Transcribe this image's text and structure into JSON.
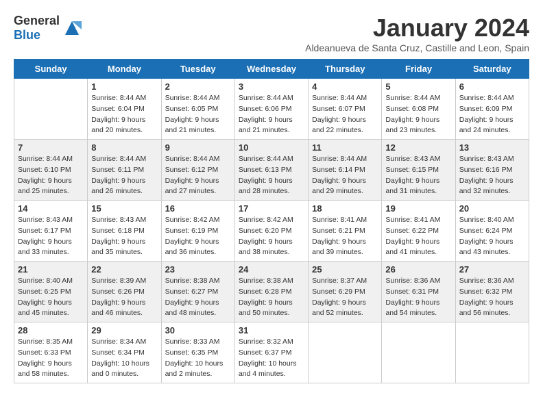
{
  "header": {
    "logo_general": "General",
    "logo_blue": "Blue",
    "month_title": "January 2024",
    "subtitle": "Aldeanueva de Santa Cruz, Castille and Leon, Spain"
  },
  "days_of_week": [
    "Sunday",
    "Monday",
    "Tuesday",
    "Wednesday",
    "Thursday",
    "Friday",
    "Saturday"
  ],
  "weeks": [
    {
      "shaded": false,
      "days": [
        {
          "number": "",
          "info": ""
        },
        {
          "number": "1",
          "info": "Sunrise: 8:44 AM\nSunset: 6:04 PM\nDaylight: 9 hours\nand 20 minutes."
        },
        {
          "number": "2",
          "info": "Sunrise: 8:44 AM\nSunset: 6:05 PM\nDaylight: 9 hours\nand 21 minutes."
        },
        {
          "number": "3",
          "info": "Sunrise: 8:44 AM\nSunset: 6:06 PM\nDaylight: 9 hours\nand 21 minutes."
        },
        {
          "number": "4",
          "info": "Sunrise: 8:44 AM\nSunset: 6:07 PM\nDaylight: 9 hours\nand 22 minutes."
        },
        {
          "number": "5",
          "info": "Sunrise: 8:44 AM\nSunset: 6:08 PM\nDaylight: 9 hours\nand 23 minutes."
        },
        {
          "number": "6",
          "info": "Sunrise: 8:44 AM\nSunset: 6:09 PM\nDaylight: 9 hours\nand 24 minutes."
        }
      ]
    },
    {
      "shaded": true,
      "days": [
        {
          "number": "7",
          "info": "Sunrise: 8:44 AM\nSunset: 6:10 PM\nDaylight: 9 hours\nand 25 minutes."
        },
        {
          "number": "8",
          "info": "Sunrise: 8:44 AM\nSunset: 6:11 PM\nDaylight: 9 hours\nand 26 minutes."
        },
        {
          "number": "9",
          "info": "Sunrise: 8:44 AM\nSunset: 6:12 PM\nDaylight: 9 hours\nand 27 minutes."
        },
        {
          "number": "10",
          "info": "Sunrise: 8:44 AM\nSunset: 6:13 PM\nDaylight: 9 hours\nand 28 minutes."
        },
        {
          "number": "11",
          "info": "Sunrise: 8:44 AM\nSunset: 6:14 PM\nDaylight: 9 hours\nand 29 minutes."
        },
        {
          "number": "12",
          "info": "Sunrise: 8:43 AM\nSunset: 6:15 PM\nDaylight: 9 hours\nand 31 minutes."
        },
        {
          "number": "13",
          "info": "Sunrise: 8:43 AM\nSunset: 6:16 PM\nDaylight: 9 hours\nand 32 minutes."
        }
      ]
    },
    {
      "shaded": false,
      "days": [
        {
          "number": "14",
          "info": "Sunrise: 8:43 AM\nSunset: 6:17 PM\nDaylight: 9 hours\nand 33 minutes."
        },
        {
          "number": "15",
          "info": "Sunrise: 8:43 AM\nSunset: 6:18 PM\nDaylight: 9 hours\nand 35 minutes."
        },
        {
          "number": "16",
          "info": "Sunrise: 8:42 AM\nSunset: 6:19 PM\nDaylight: 9 hours\nand 36 minutes."
        },
        {
          "number": "17",
          "info": "Sunrise: 8:42 AM\nSunset: 6:20 PM\nDaylight: 9 hours\nand 38 minutes."
        },
        {
          "number": "18",
          "info": "Sunrise: 8:41 AM\nSunset: 6:21 PM\nDaylight: 9 hours\nand 39 minutes."
        },
        {
          "number": "19",
          "info": "Sunrise: 8:41 AM\nSunset: 6:22 PM\nDaylight: 9 hours\nand 41 minutes."
        },
        {
          "number": "20",
          "info": "Sunrise: 8:40 AM\nSunset: 6:24 PM\nDaylight: 9 hours\nand 43 minutes."
        }
      ]
    },
    {
      "shaded": true,
      "days": [
        {
          "number": "21",
          "info": "Sunrise: 8:40 AM\nSunset: 6:25 PM\nDaylight: 9 hours\nand 45 minutes."
        },
        {
          "number": "22",
          "info": "Sunrise: 8:39 AM\nSunset: 6:26 PM\nDaylight: 9 hours\nand 46 minutes."
        },
        {
          "number": "23",
          "info": "Sunrise: 8:38 AM\nSunset: 6:27 PM\nDaylight: 9 hours\nand 48 minutes."
        },
        {
          "number": "24",
          "info": "Sunrise: 8:38 AM\nSunset: 6:28 PM\nDaylight: 9 hours\nand 50 minutes."
        },
        {
          "number": "25",
          "info": "Sunrise: 8:37 AM\nSunset: 6:29 PM\nDaylight: 9 hours\nand 52 minutes."
        },
        {
          "number": "26",
          "info": "Sunrise: 8:36 AM\nSunset: 6:31 PM\nDaylight: 9 hours\nand 54 minutes."
        },
        {
          "number": "27",
          "info": "Sunrise: 8:36 AM\nSunset: 6:32 PM\nDaylight: 9 hours\nand 56 minutes."
        }
      ]
    },
    {
      "shaded": false,
      "days": [
        {
          "number": "28",
          "info": "Sunrise: 8:35 AM\nSunset: 6:33 PM\nDaylight: 9 hours\nand 58 minutes."
        },
        {
          "number": "29",
          "info": "Sunrise: 8:34 AM\nSunset: 6:34 PM\nDaylight: 10 hours\nand 0 minutes."
        },
        {
          "number": "30",
          "info": "Sunrise: 8:33 AM\nSunset: 6:35 PM\nDaylight: 10 hours\nand 2 minutes."
        },
        {
          "number": "31",
          "info": "Sunrise: 8:32 AM\nSunset: 6:37 PM\nDaylight: 10 hours\nand 4 minutes."
        },
        {
          "number": "",
          "info": ""
        },
        {
          "number": "",
          "info": ""
        },
        {
          "number": "",
          "info": ""
        }
      ]
    }
  ]
}
